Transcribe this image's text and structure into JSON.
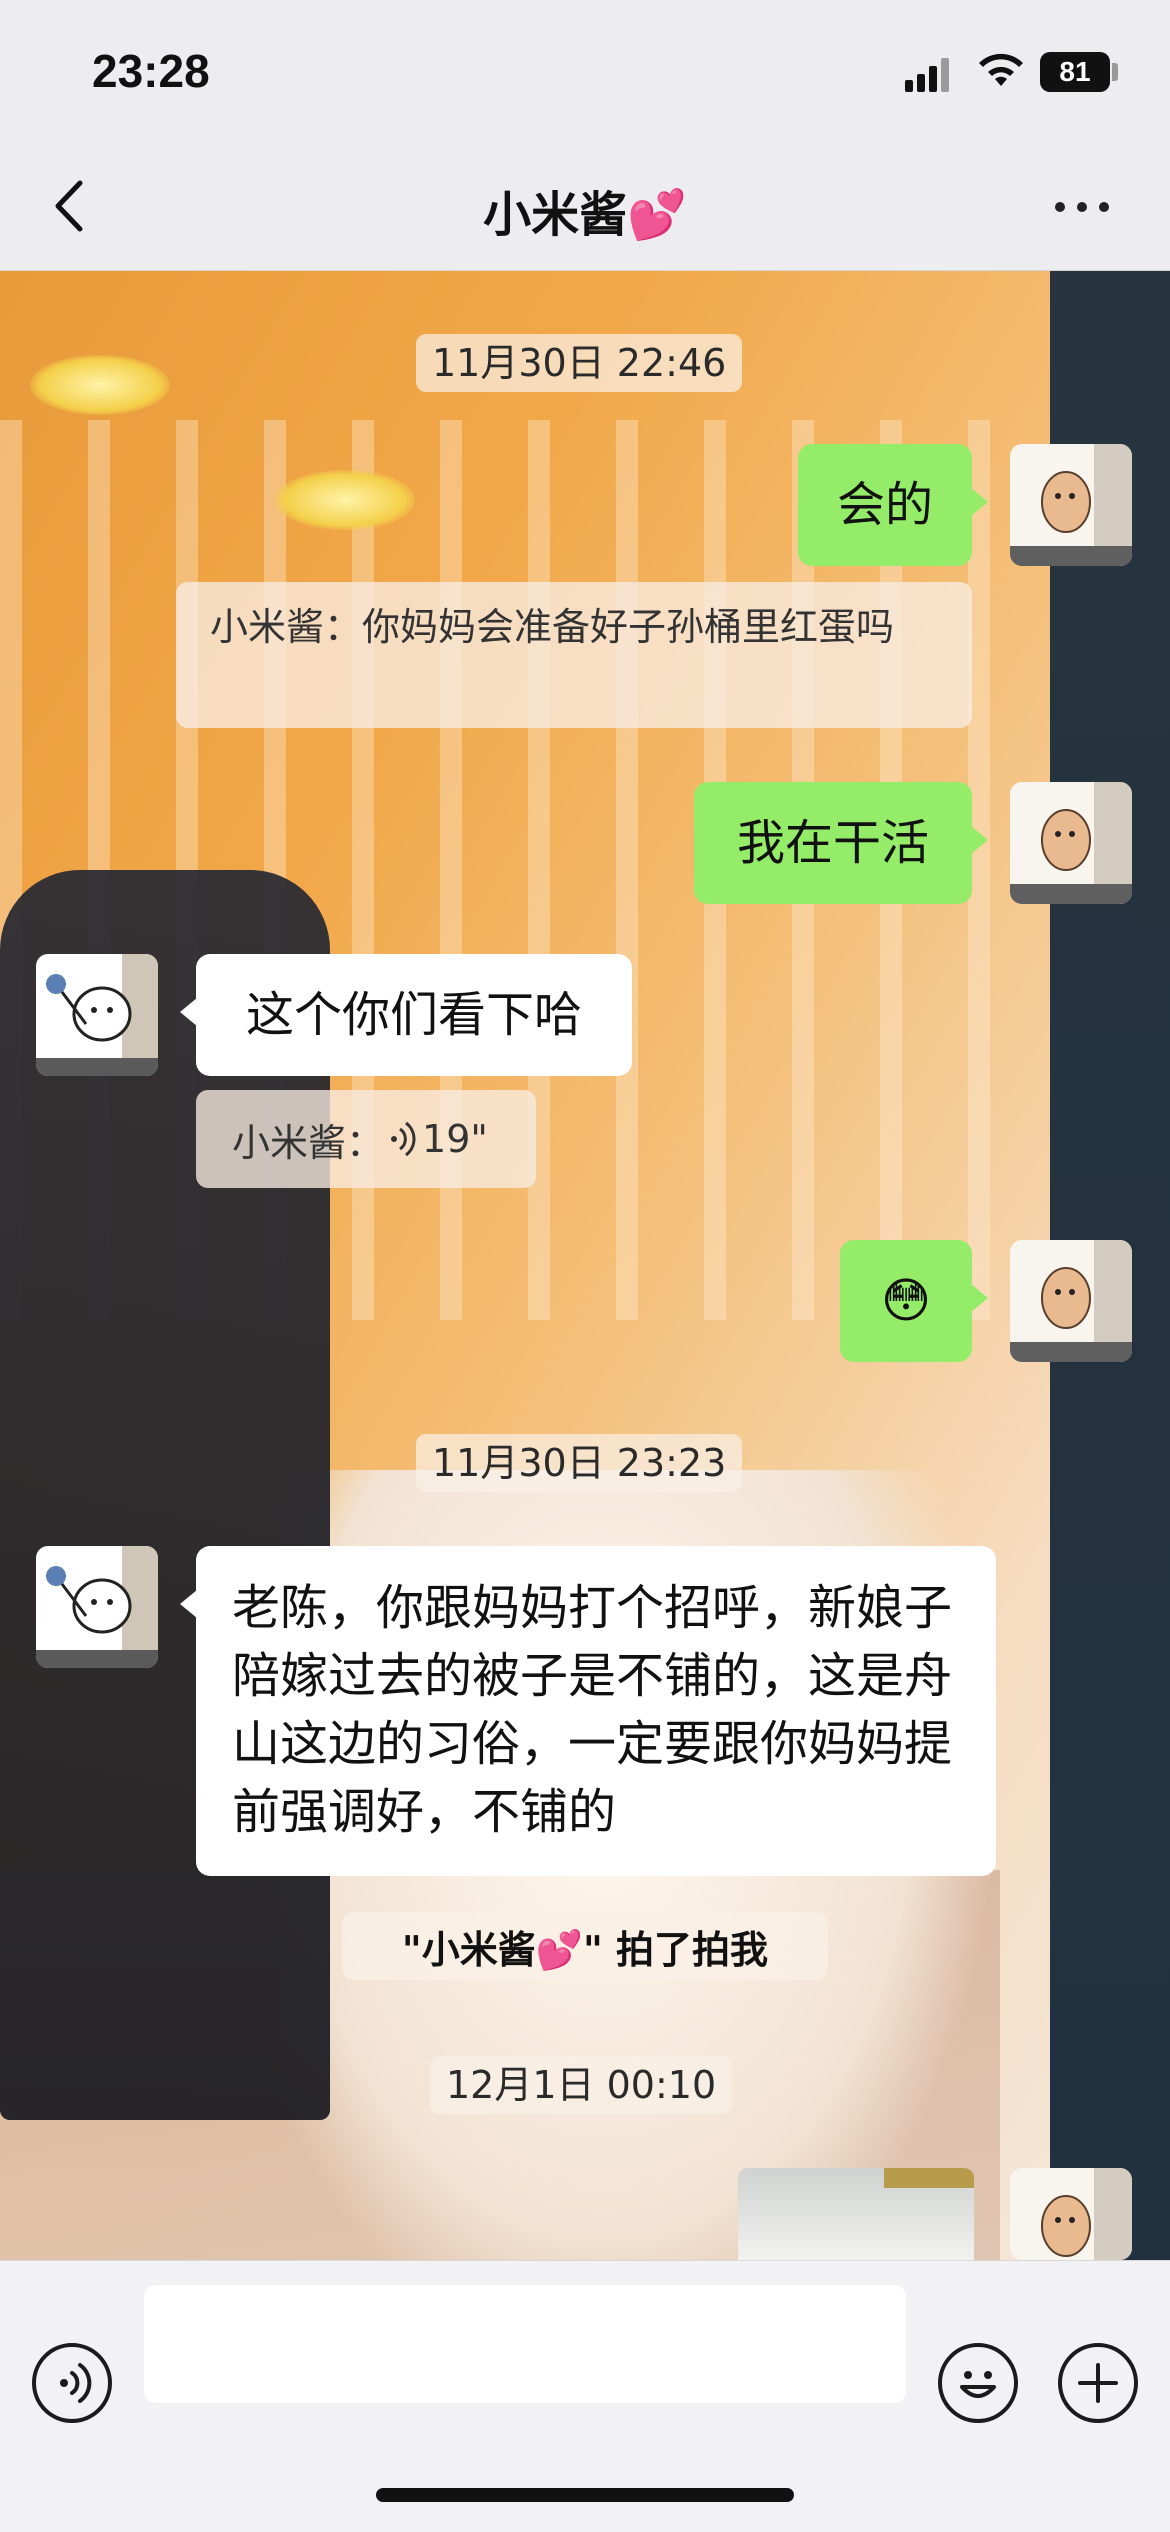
{
  "status_bar": {
    "time": "23:28",
    "battery": "81"
  },
  "header": {
    "title": "小米酱💕"
  },
  "messages": {
    "ts1": "11月30日 22:46",
    "m1": "会的",
    "q1": "小米酱：你妈妈会准备好子孙桶里红蛋吗",
    "m2": "我在干活",
    "m3": "这个你们看下哈",
    "q2_sender": "小米酱：",
    "q2_duration": "19\"",
    "m4": "😳",
    "ts2": "11月30日 23:23",
    "m5": "老陈，你跟妈妈打个招呼，新娘子陪嫁过去的被子是不铺的，这是舟山这边的习俗，一定要跟你妈妈提前强调好，不铺的",
    "pat": "\"小米酱💕\" 拍了拍我",
    "ts3": "12月1日 00:10"
  },
  "input": {
    "value": ""
  },
  "colors": {
    "bubble_self": "#95ec69",
    "bubble_other": "#ffffff",
    "bar_background": "#ededf0"
  },
  "icons": {
    "back": "chevron-left-icon",
    "more": "more-dots-icon",
    "voice": "voice-input-icon",
    "emoji": "emoji-icon",
    "plus": "plus-icon"
  }
}
